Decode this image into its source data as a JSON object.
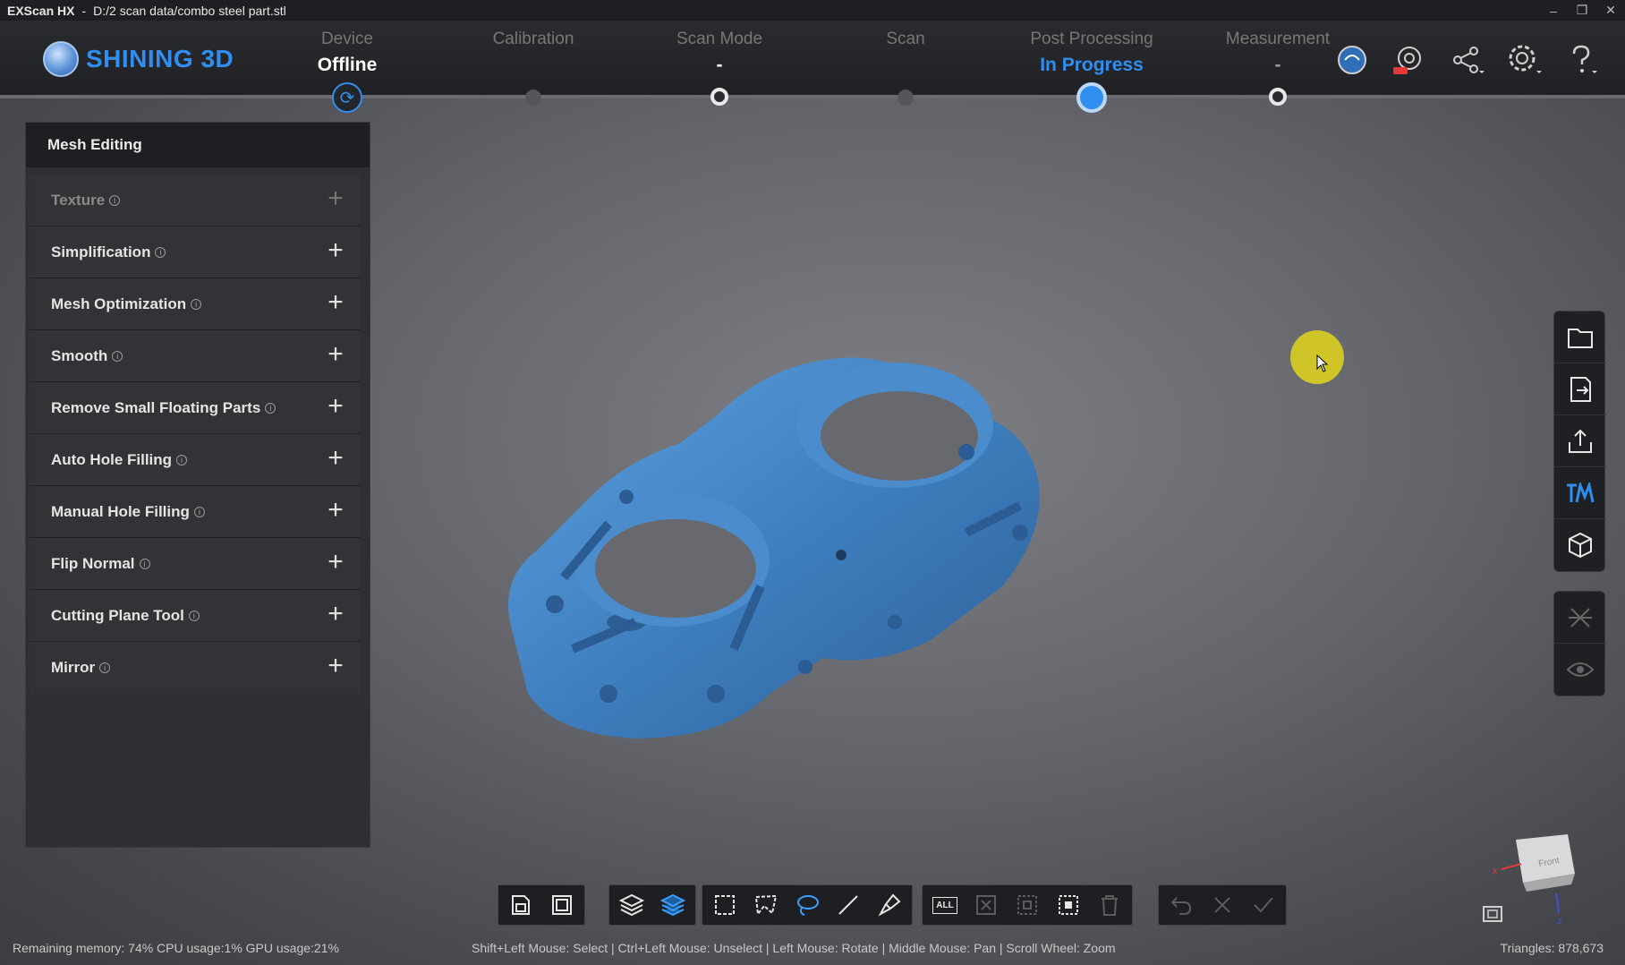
{
  "window": {
    "app_name": "EXScan HX",
    "separator": "-",
    "file_path": "D:/2 scan data/combo steel  part.stl",
    "controls": [
      "–",
      "❐",
      "✕"
    ]
  },
  "brand": {
    "logo_text": "SHINING 3D"
  },
  "workflow": [
    {
      "label": "Device",
      "value": "Offline",
      "state": "current"
    },
    {
      "label": "Calibration",
      "value": "",
      "state": "pending"
    },
    {
      "label": "Scan Mode",
      "value": "-",
      "state": "done"
    },
    {
      "label": "Scan",
      "value": "",
      "state": "pending"
    },
    {
      "label": "Post Processing",
      "value": "In Progress",
      "state": "active"
    },
    {
      "label": "Measurement",
      "value": "-",
      "state": "done"
    }
  ],
  "header_icons": [
    "model-icon",
    "new-service-icon",
    "share-icon",
    "settings-icon",
    "help-icon"
  ],
  "panel": {
    "title": "Mesh Editing",
    "items": [
      {
        "label": "Texture",
        "enabled": false
      },
      {
        "label": "Simplification",
        "enabled": true
      },
      {
        "label": "Mesh Optimization",
        "enabled": true
      },
      {
        "label": "Smooth",
        "enabled": true
      },
      {
        "label": "Remove Small Floating Parts",
        "enabled": true
      },
      {
        "label": "Auto Hole Filling",
        "enabled": true
      },
      {
        "label": "Manual Hole Filling",
        "enabled": true
      },
      {
        "label": "Flip Normal",
        "enabled": true
      },
      {
        "label": "Cutting Plane Tool",
        "enabled": true
      },
      {
        "label": "Mirror",
        "enabled": true
      }
    ],
    "info_glyph": "i",
    "plus_glyph": "+"
  },
  "bottom_toolbar": {
    "select_all_label": "ALL"
  },
  "status": {
    "left": "Remaining memory: 74% CPU usage:1%  GPU usage:21%",
    "center": "Shift+Left Mouse: Select | Ctrl+Left Mouse: Unselect | Left Mouse: Rotate | Middle Mouse: Pan | Scroll Wheel: Zoom",
    "right": "Triangles: 878,673"
  },
  "view_cube": {
    "face_label": "Front",
    "axis_x": "x",
    "axis_z": "z"
  },
  "colors": {
    "accent": "#2f8ef0",
    "model": "#3f7fbf",
    "cursor_highlight": "#cfc528"
  }
}
